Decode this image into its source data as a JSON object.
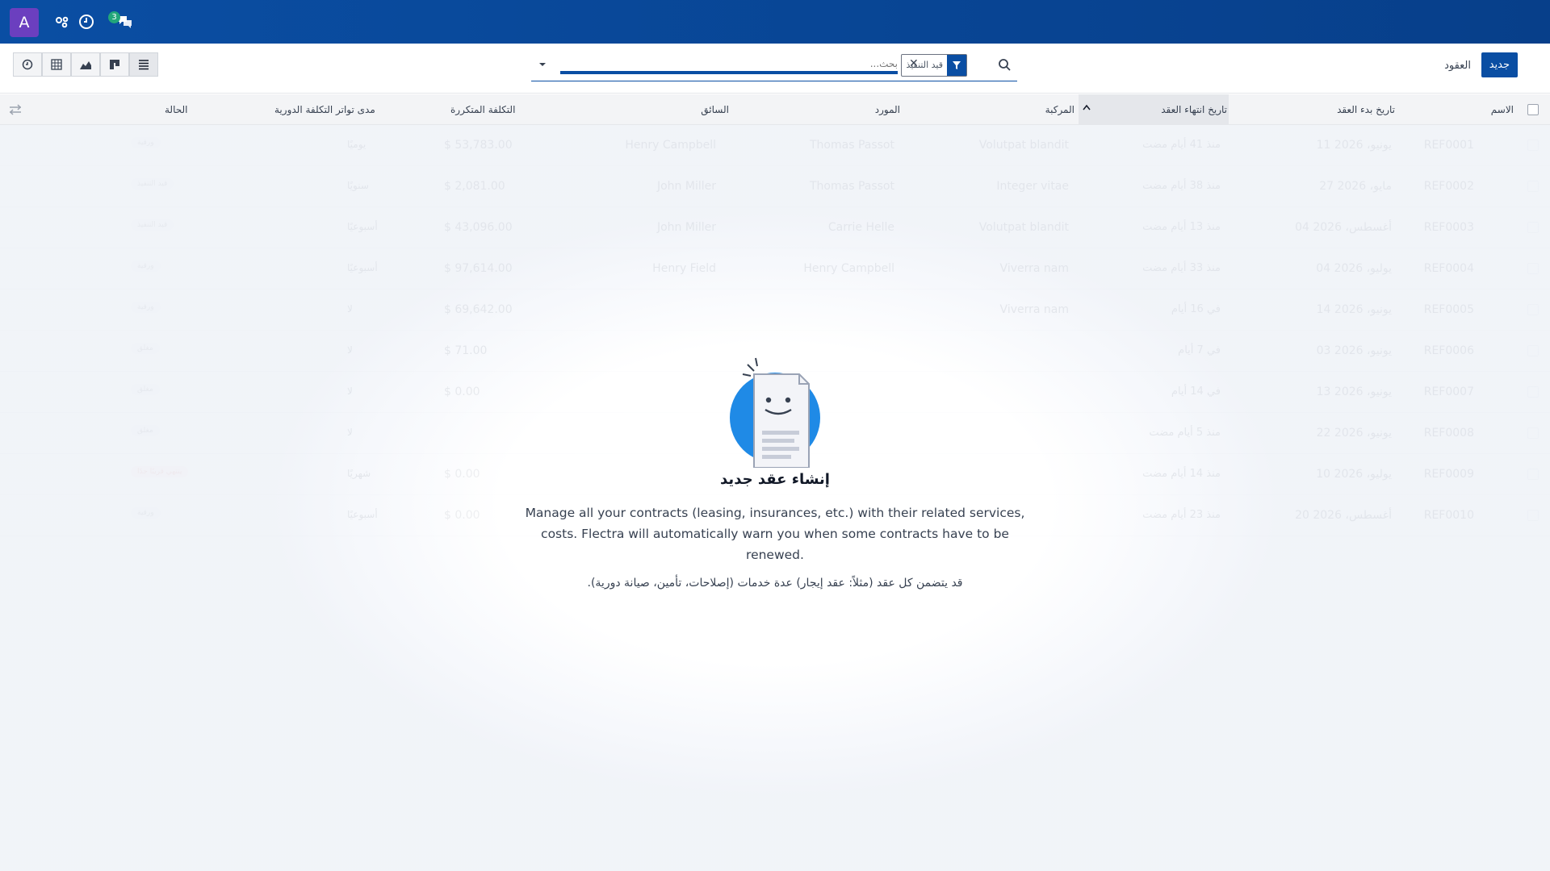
{
  "navbar": {
    "avatar_letter": "A",
    "messages_count": "3",
    "icons": [
      "apps-icon",
      "clock-icon",
      "chat-icon"
    ],
    "bg_color": "#0a4ea3"
  },
  "control": {
    "new_label": "جديد",
    "breadcrumb": "العقود",
    "search_placeholder": "بحث...",
    "facet_label": "قيد التنفيذ",
    "view_buttons": [
      "activity-view",
      "pivot-view",
      "graph-view",
      "kanban-view",
      "list-view"
    ]
  },
  "table": {
    "headers": {
      "name": "الاسم",
      "start": "تاريخ بدء العقد",
      "end": "تاريخ انتهاء العقد",
      "vehicle": "المركبة",
      "vendor": "المورد",
      "driver": "السائق",
      "cost": "التكلفة المتكررة",
      "frequency": "مدى تواتر التكلفة الدورية",
      "state": "الحالة"
    },
    "rows": [
      {
        "name": "REF0001",
        "start": "11 يونيو، 2026",
        "end": "منذ 41 أيام مضت",
        "vehicle": "Volutpat blandit",
        "vendor": "Thomas Passot",
        "driver": "Henry Campbell",
        "cost": "$ 53,783.00",
        "frequency": "يوميًا",
        "state": "ورقية"
      },
      {
        "name": "REF0002",
        "start": "27 مايو، 2026",
        "end": "منذ 38 أيام مضت",
        "vehicle": "Integer vitae",
        "vendor": "Thomas Passot",
        "driver": "John Miller",
        "cost": "$ 2,081.00",
        "frequency": "سنويًا",
        "state": "قيد التنفيذ"
      },
      {
        "name": "REF0003",
        "start": "04 أغسطس، 2026",
        "end": "منذ 13 أيام مضت",
        "vehicle": "Volutpat blandit",
        "vendor": "Carrie Helle",
        "driver": "John Miller",
        "cost": "$ 43,096.00",
        "frequency": "أسبوعيًا",
        "state": "قيد التنفيذ"
      },
      {
        "name": "REF0004",
        "start": "04 يوليو، 2026",
        "end": "منذ 33 أيام مضت",
        "vehicle": "Viverra nam",
        "vendor": "Henry Campbell",
        "driver": "Henry Field",
        "cost": "$ 97,614.00",
        "frequency": "أسبوعيًا",
        "state": "ورقية"
      },
      {
        "name": "REF0005",
        "start": "14 يونيو، 2026",
        "end": "في 16 أيام",
        "vehicle": "Viverra nam",
        "vendor": "",
        "driver": "",
        "cost": "$ 69,642.00",
        "frequency": "لا",
        "state": "ورقية"
      },
      {
        "name": "REF0006",
        "start": "03 يونيو، 2026",
        "end": "في 7 أيام",
        "vehicle": "",
        "vendor": "",
        "driver": "",
        "cost": "$ 71.00",
        "frequency": "لا",
        "state": "مغلق"
      },
      {
        "name": "REF0007",
        "start": "13 يونيو، 2026",
        "end": "في 14 أيام",
        "vehicle": "",
        "vendor": "",
        "driver": "",
        "cost": "$ 0.00",
        "frequency": "لا",
        "state": "مغلق"
      },
      {
        "name": "REF0008",
        "start": "22 يونيو، 2026",
        "end": "منذ 5 أيام مضت",
        "vehicle": "",
        "vendor": "",
        "driver": "",
        "cost": "",
        "frequency": "لا",
        "state": "مغلق"
      },
      {
        "name": "REF0009",
        "start": "10 يوليو، 2026",
        "end": "منذ 14 أيام مضت",
        "vehicle": "",
        "vendor": "",
        "driver": "",
        "cost": "$ 0.00",
        "frequency": "شهريًا",
        "state": "ينتهي قريبًا جدًا"
      },
      {
        "name": "REF0010",
        "start": "20 أغسطس، 2026",
        "end": "منذ 23 أيام مضت",
        "vehicle": "",
        "vendor": "",
        "driver": "",
        "cost": "$ 0.00",
        "frequency": "أسبوعيًا",
        "state": "ورقية"
      }
    ]
  },
  "helper": {
    "title": "إنشاء عقد جديد",
    "text": "Manage all your contracts (leasing, insurances, etc.) with their related services, costs. Flectra will automatically warn you when some contracts have to be renewed.",
    "arabic_note": "قد يتضمن كل عقد (مثلاً: عقد إيجار) عدة خدمات (إصلاحات، تأمين، صيانة دورية)."
  }
}
